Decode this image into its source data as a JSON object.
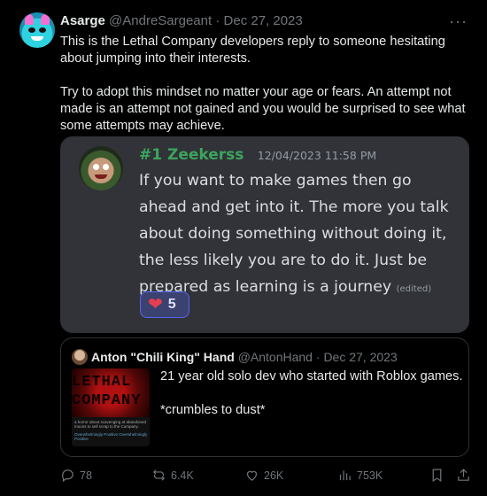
{
  "post": {
    "display_name": "Asarge",
    "handle": "@AndreSargeant",
    "separator": "·",
    "date": "Dec 27, 2023",
    "more_icon": "more-icon",
    "paragraphs": [
      "This is the Lethal Company developers reply to someone hesitating about jumping into their interests.",
      "Try to adopt this mindset no matter your age or fears. An attempt not made is an attempt not gained and you would be surprised to see what some attempts may achieve."
    ]
  },
  "discord": {
    "username": "#1 Zeekerss",
    "timestamp": "12/04/2023 11:58 PM",
    "message": "If you want to make games then go ahead and get into it. The more you talk about doing something without doing it, the less likely you are to do it. Just be prepared as learning is a journey",
    "edited": "(edited)",
    "reaction_emoji": "❤",
    "reaction_count": "5"
  },
  "quote": {
    "display_name": "Anton \"Chili King\" Hand",
    "handle": "@AntonHand",
    "separator": "·",
    "date": "Dec 27, 2023",
    "thumb_line1": "LETHAL",
    "thumb_line2": "COMPANY",
    "thumb_small1": "a horror about scavenging at abandoned moons to sell scrap to the Company.",
    "thumb_small2": "Overwhelmingly Positive  Overwhelmingly Positive",
    "lines": [
      "21 year old solo dev who started with Roblox games.",
      "*crumbles to dust*"
    ]
  },
  "actions": {
    "replies": "78",
    "reposts": "6.4K",
    "likes": "26K",
    "views": "753K"
  },
  "colors": {
    "background": "#000000",
    "discord_bg": "#313338",
    "discord_name": "#3ba55d",
    "muted": "#71767b"
  }
}
